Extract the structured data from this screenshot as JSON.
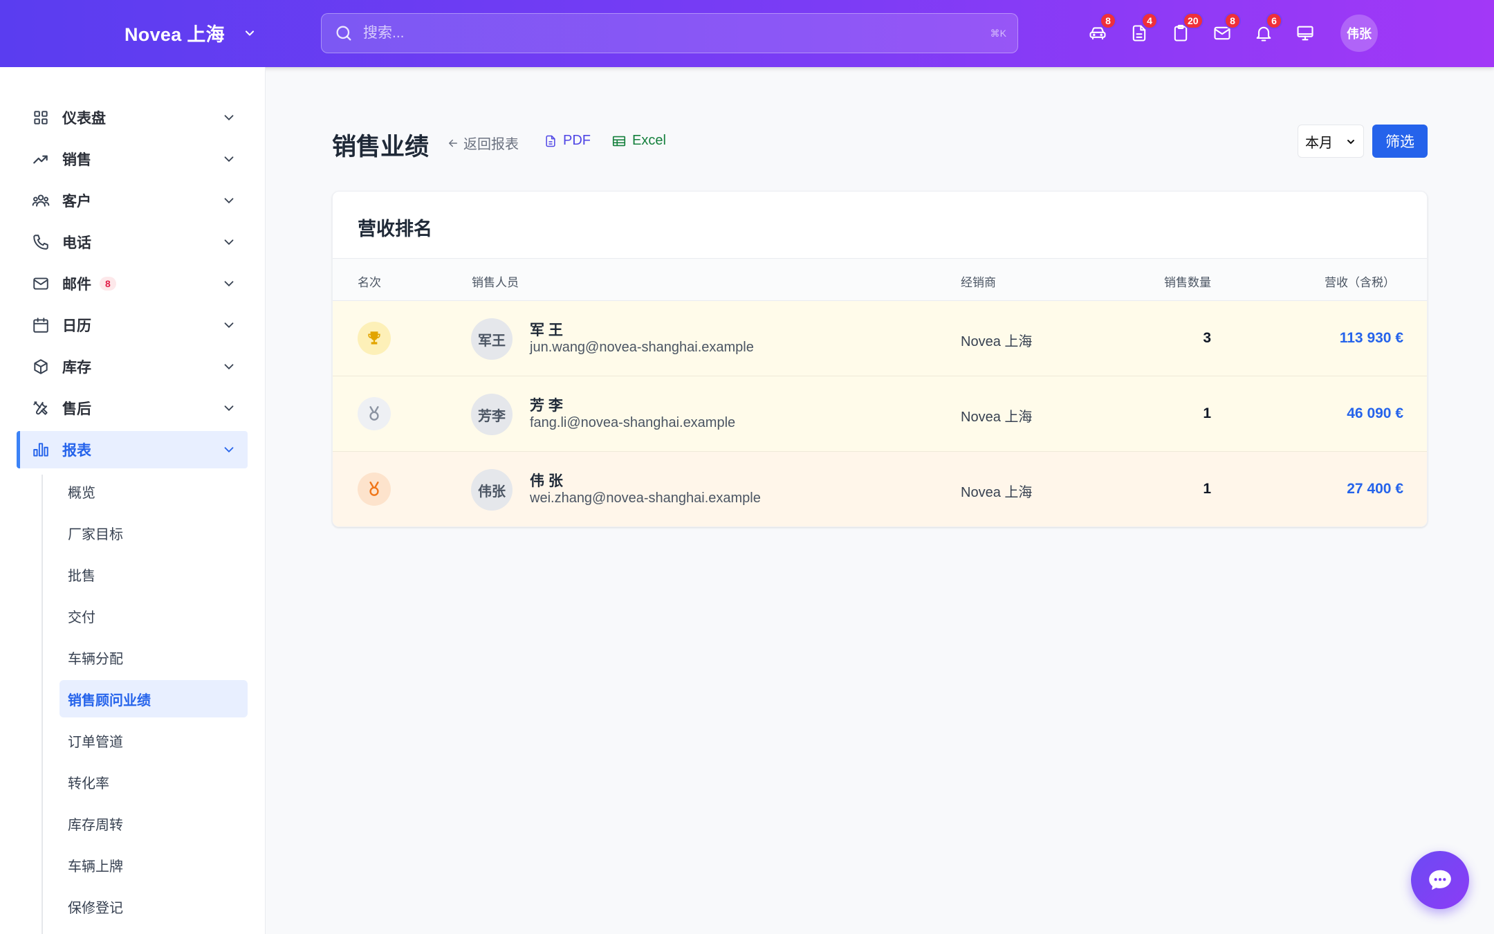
{
  "header": {
    "brand": "Novea 上海",
    "search_placeholder": "搜索...",
    "search_shortcut": "⌘K",
    "icons": [
      {
        "name": "car-icon",
        "badge": "8"
      },
      {
        "name": "document-icon",
        "badge": "4"
      },
      {
        "name": "clipboard-icon",
        "badge": "20"
      },
      {
        "name": "mail-icon",
        "badge": "8"
      },
      {
        "name": "bell-icon",
        "badge": "6"
      },
      {
        "name": "monitor-icon",
        "badge": ""
      }
    ],
    "user_initials": "伟张"
  },
  "sidebar": {
    "items": [
      {
        "label": "仪表盘",
        "icon": "grid-icon"
      },
      {
        "label": "销售",
        "icon": "trend-icon"
      },
      {
        "label": "客户",
        "icon": "users-icon"
      },
      {
        "label": "电话",
        "icon": "phone-icon"
      },
      {
        "label": "邮件",
        "icon": "mail-icon",
        "badge": "8"
      },
      {
        "label": "日历",
        "icon": "calendar-icon"
      },
      {
        "label": "库存",
        "icon": "box-icon"
      },
      {
        "label": "售后",
        "icon": "tools-icon"
      },
      {
        "label": "报表",
        "icon": "chart-icon",
        "active": true
      }
    ],
    "sub_items": [
      "概览",
      "厂家目标",
      "批售",
      "交付",
      "车辆分配",
      "销售顾问业绩",
      "订单管道",
      "转化率",
      "库存周转",
      "车辆上牌",
      "保修登记"
    ],
    "active_sub": "销售顾问业绩"
  },
  "main": {
    "title": "销售业绩",
    "back_label": "返回报表",
    "pdf_label": "PDF",
    "excel_label": "Excel",
    "period": "本月",
    "filter_label": "筛选",
    "card_title": "营收排名",
    "columns": [
      "名次",
      "销售人员",
      "经销商",
      "销售数量",
      "营收（含税）"
    ],
    "rows": [
      {
        "medal": "trophy-icon",
        "initials": "军王",
        "name": "军 王",
        "email": "jun.wang@novea-shanghai.example",
        "dealer": "Novea 上海",
        "qty": "3",
        "revenue": "113 930 €",
        "row_bg": "#fffbea",
        "medal_bg": "#fdf0b8",
        "medal_color": "#e2a400"
      },
      {
        "medal": "medal-icon",
        "initials": "芳李",
        "name": "芳 李",
        "email": "fang.li@novea-shanghai.example",
        "dealer": "Novea 上海",
        "qty": "1",
        "revenue": "46 090 €",
        "row_bg": "#fffbea",
        "medal_bg": "#eef0f4",
        "medal_color": "#8b93a1"
      },
      {
        "medal": "medal-icon",
        "initials": "伟张",
        "name": "伟 张",
        "email": "wei.zhang@novea-shanghai.example",
        "dealer": "Novea 上海",
        "qty": "1",
        "revenue": "27 400 €",
        "row_bg": "#fff6ea",
        "medal_bg": "#fde3cc",
        "medal_color": "#f07518"
      }
    ]
  },
  "colors": {
    "accent": "#2563eb",
    "header_start": "#5a3df0",
    "header_end": "#a238f7",
    "badge": "#ef2f3a"
  }
}
